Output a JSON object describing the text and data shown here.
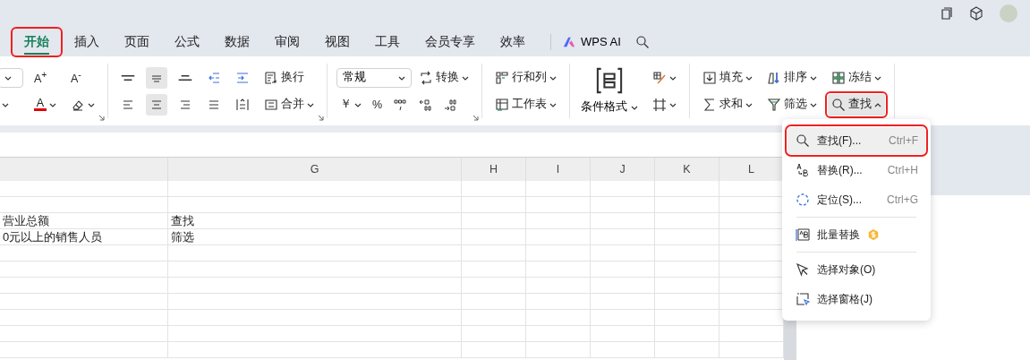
{
  "tabs": [
    {
      "label": "开始",
      "selected": true,
      "highlighted": true
    },
    {
      "label": "插入",
      "selected": false,
      "highlighted": false
    },
    {
      "label": "页面",
      "selected": false,
      "highlighted": false
    },
    {
      "label": "公式",
      "selected": false,
      "highlighted": false
    },
    {
      "label": "数据",
      "selected": false,
      "highlighted": false
    },
    {
      "label": "审阅",
      "selected": false,
      "highlighted": false
    },
    {
      "label": "视图",
      "selected": false,
      "highlighted": false
    },
    {
      "label": "工具",
      "selected": false,
      "highlighted": false
    },
    {
      "label": "会员专享",
      "selected": false,
      "highlighted": false
    },
    {
      "label": "效率",
      "selected": false,
      "highlighted": false
    }
  ],
  "ai_button": {
    "label": "WPS AI"
  },
  "ribbon": {
    "groups": [
      {
        "launcher": true,
        "rows": [
          [
            {
              "kind": "field",
              "dropdown": true
            },
            {
              "kind": "text",
              "label": "A$^{+}$"
            },
            {
              "kind": "text",
              "label": "A$^{-}$"
            }
          ],
          [
            {
              "kind": "icon",
              "dropdown": true
            },
            {
              "kind": "font-color",
              "label": "A",
              "dropdown": true
            },
            {
              "kind": "icon",
              "dropdown": true
            }
          ]
        ]
      },
      {
        "launcher": true,
        "rows": [
          [
            {
              "kind": "icon",
              "selected": false
            },
            {
              "kind": "icon",
              "selected": true
            },
            {
              "kind": "icon",
              "selected": false
            },
            {
              "kind": "icon",
              "selected": false
            },
            {
              "kind": "icon",
              "selected": false
            },
            {
              "kind": "icon",
              "label": "换行",
              "selected": false
            }
          ],
          [
            {
              "kind": "icon",
              "selected": false
            },
            {
              "kind": "icon",
              "selected": true
            },
            {
              "kind": "icon",
              "selected": false
            },
            {
              "kind": "icon",
              "selected": false
            },
            {
              "kind": "icon",
              "selected": false
            },
            {
              "kind": "icon",
              "label": "合并",
              "dropdown": true,
              "selected": false
            }
          ]
        ]
      },
      {
        "launcher": true,
        "rows": [
          [
            {
              "kind": "field",
              "label": "常规",
              "dropdown": true
            },
            {
              "kind": "icon",
              "label": "转换",
              "dropdown": true
            }
          ],
          [
            {
              "kind": "text",
              "label": "￥",
              "dropdown": true
            },
            {
              "kind": "text",
              "label": "%"
            },
            {
              "kind": "icon"
            },
            {
              "kind": "icon"
            },
            {
              "kind": "icon"
            }
          ]
        ]
      },
      {
        "launcher": false,
        "rows": [
          [
            {
              "kind": "icon",
              "label": "行和列",
              "dropdown": true
            }
          ],
          [
            {
              "kind": "icon",
              "label": "工作表",
              "dropdown": true
            }
          ]
        ]
      },
      {
        "launcher": false,
        "large": {
          "label": "条件格式",
          "dropdown": true
        },
        "rows": [
          [
            {
              "kind": "icon",
              "dropdown": true
            }
          ],
          [
            {
              "kind": "icon",
              "dropdown": true
            }
          ]
        ]
      },
      {
        "launcher": false,
        "rows": [
          [
            {
              "kind": "icon",
              "label": "填充",
              "dropdown": true
            },
            {
              "kind": "icon",
              "label": "排序",
              "dropdown": true
            },
            {
              "kind": "icon",
              "label": "冻结",
              "dropdown": true
            }
          ],
          [
            {
              "kind": "icon",
              "label": "求和",
              "dropdown": true
            },
            {
              "kind": "icon",
              "label": "筛选",
              "dropdown": true
            },
            {
              "kind": "icon",
              "label": "查找",
              "expanded": true,
              "highlighted": true
            }
          ]
        ]
      }
    ]
  },
  "sheet": {
    "columns": [
      "G",
      "H",
      "I",
      "J",
      "K",
      "L"
    ],
    "rows": [
      [
        "营业总额",
        "查找"
      ],
      [
        "0元以上的销售人员",
        "筛选"
      ]
    ]
  },
  "menu": {
    "sections": [
      [
        {
          "label": "查找(F)...",
          "shortcut": "Ctrl+F",
          "selected": true,
          "highlighted": true
        },
        {
          "label": "替换(R)...",
          "shortcut": "Ctrl+H",
          "selected": false,
          "highlighted": false
        },
        {
          "label": "定位(S)...",
          "shortcut": "Ctrl+G",
          "selected": false,
          "highlighted": false
        }
      ],
      [
        {
          "label": "批量替换",
          "premium": true,
          "selected": false,
          "highlighted": false
        }
      ],
      [
        {
          "label": "选择对象(O)",
          "selected": false,
          "highlighted": false
        },
        {
          "label": "选择窗格(J)",
          "selected": false,
          "highlighted": false
        }
      ]
    ]
  }
}
